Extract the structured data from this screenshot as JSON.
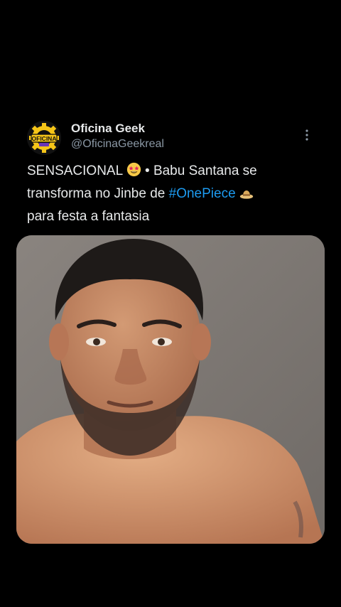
{
  "tweet": {
    "author": {
      "name": "Oficina Geek",
      "handle": "@OficinaGeekreal",
      "avatar_logo_text": "OFICINA"
    },
    "text": {
      "part1": "SENSACIONAL",
      "part2": " • Babu Santana se transforma no Jinbe de ",
      "hashtag": "#OnePiece",
      "part3": "para festa a fantasia"
    },
    "icons": {
      "more": "more-vertical-icon",
      "emoji1": "star-struck-emoji",
      "emoji2": "straw-hat-emoji"
    },
    "media": {
      "type": "photo",
      "subject": "shirtless man portrait"
    }
  },
  "colors": {
    "background": "#000000",
    "text": "#e7e9ea",
    "secondary": "#8b98a5",
    "link": "#1d9bf0",
    "avatar_yellow": "#f5c518"
  }
}
